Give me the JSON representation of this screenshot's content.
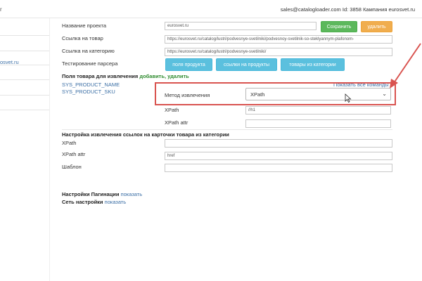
{
  "header": {
    "brand": "r",
    "account_info": "sales@catalogloader.com Id: 3858 Кампания eurosvet.ru"
  },
  "sidebar": {
    "active_item": "osvet.ru"
  },
  "form": {
    "project_name": {
      "label": "Название проекта",
      "value": "eurosvet.ru"
    },
    "save_label": "Сохранить",
    "delete_label": "удалить",
    "product_link": {
      "label": "Ссылка на товар",
      "value": "https://eurosvet.ru/catalog/lustri/podvesnye-svetilniki/podvesnoy-svetilnik-so-steklyannym-plafonom-"
    },
    "category_link": {
      "label": "Ссылка на категорию",
      "value": "https://eurosvet.ru/catalog/lustri/podvesnye-svetilniki/"
    },
    "parser_test": {
      "label": "Тестирование парсера",
      "buttons": [
        "поля продукта",
        "ссылки на продукты",
        "товары из категории"
      ]
    },
    "extract_fields": {
      "title": "Поля товара для извлечения",
      "add_link": "добавить",
      "separator": ",",
      "delete_link": "удалить",
      "fields": [
        "SYS_PRODUCT_NAME",
        "SYS_PRODUCT_SKU"
      ],
      "show_all_commands": "Показать все команды"
    },
    "method": {
      "label": "Метод извлечения",
      "value": "XPath"
    },
    "xpath": {
      "label": "XPath",
      "value": "//h1"
    },
    "xpath_attr": {
      "label": "XPath attr",
      "value": ""
    },
    "links_setup": {
      "title": "Настройка извлечения ссылок на карточки товара из категории",
      "xpath": {
        "label": "XPath",
        "value": ""
      },
      "xpath_attr": {
        "label": "XPath attr",
        "value": "href"
      },
      "template": {
        "label": "Шаблон",
        "value": ""
      }
    },
    "pagination": {
      "label": "Настройки Пагинации",
      "link": "показать"
    },
    "network": {
      "label": "Сеть настройки",
      "link": "показать"
    }
  },
  "colors": {
    "accent_green": "#5cb85c",
    "accent_orange": "#f0ad4e",
    "accent_cyan": "#5bc0de",
    "highlight_red": "#d9534f",
    "link_blue": "#3a6ea5"
  },
  "icons": {
    "select_chevron": "chevron-down-icon",
    "cursor": "mouse-pointer-icon",
    "annotation": "red-arrow-icon"
  }
}
